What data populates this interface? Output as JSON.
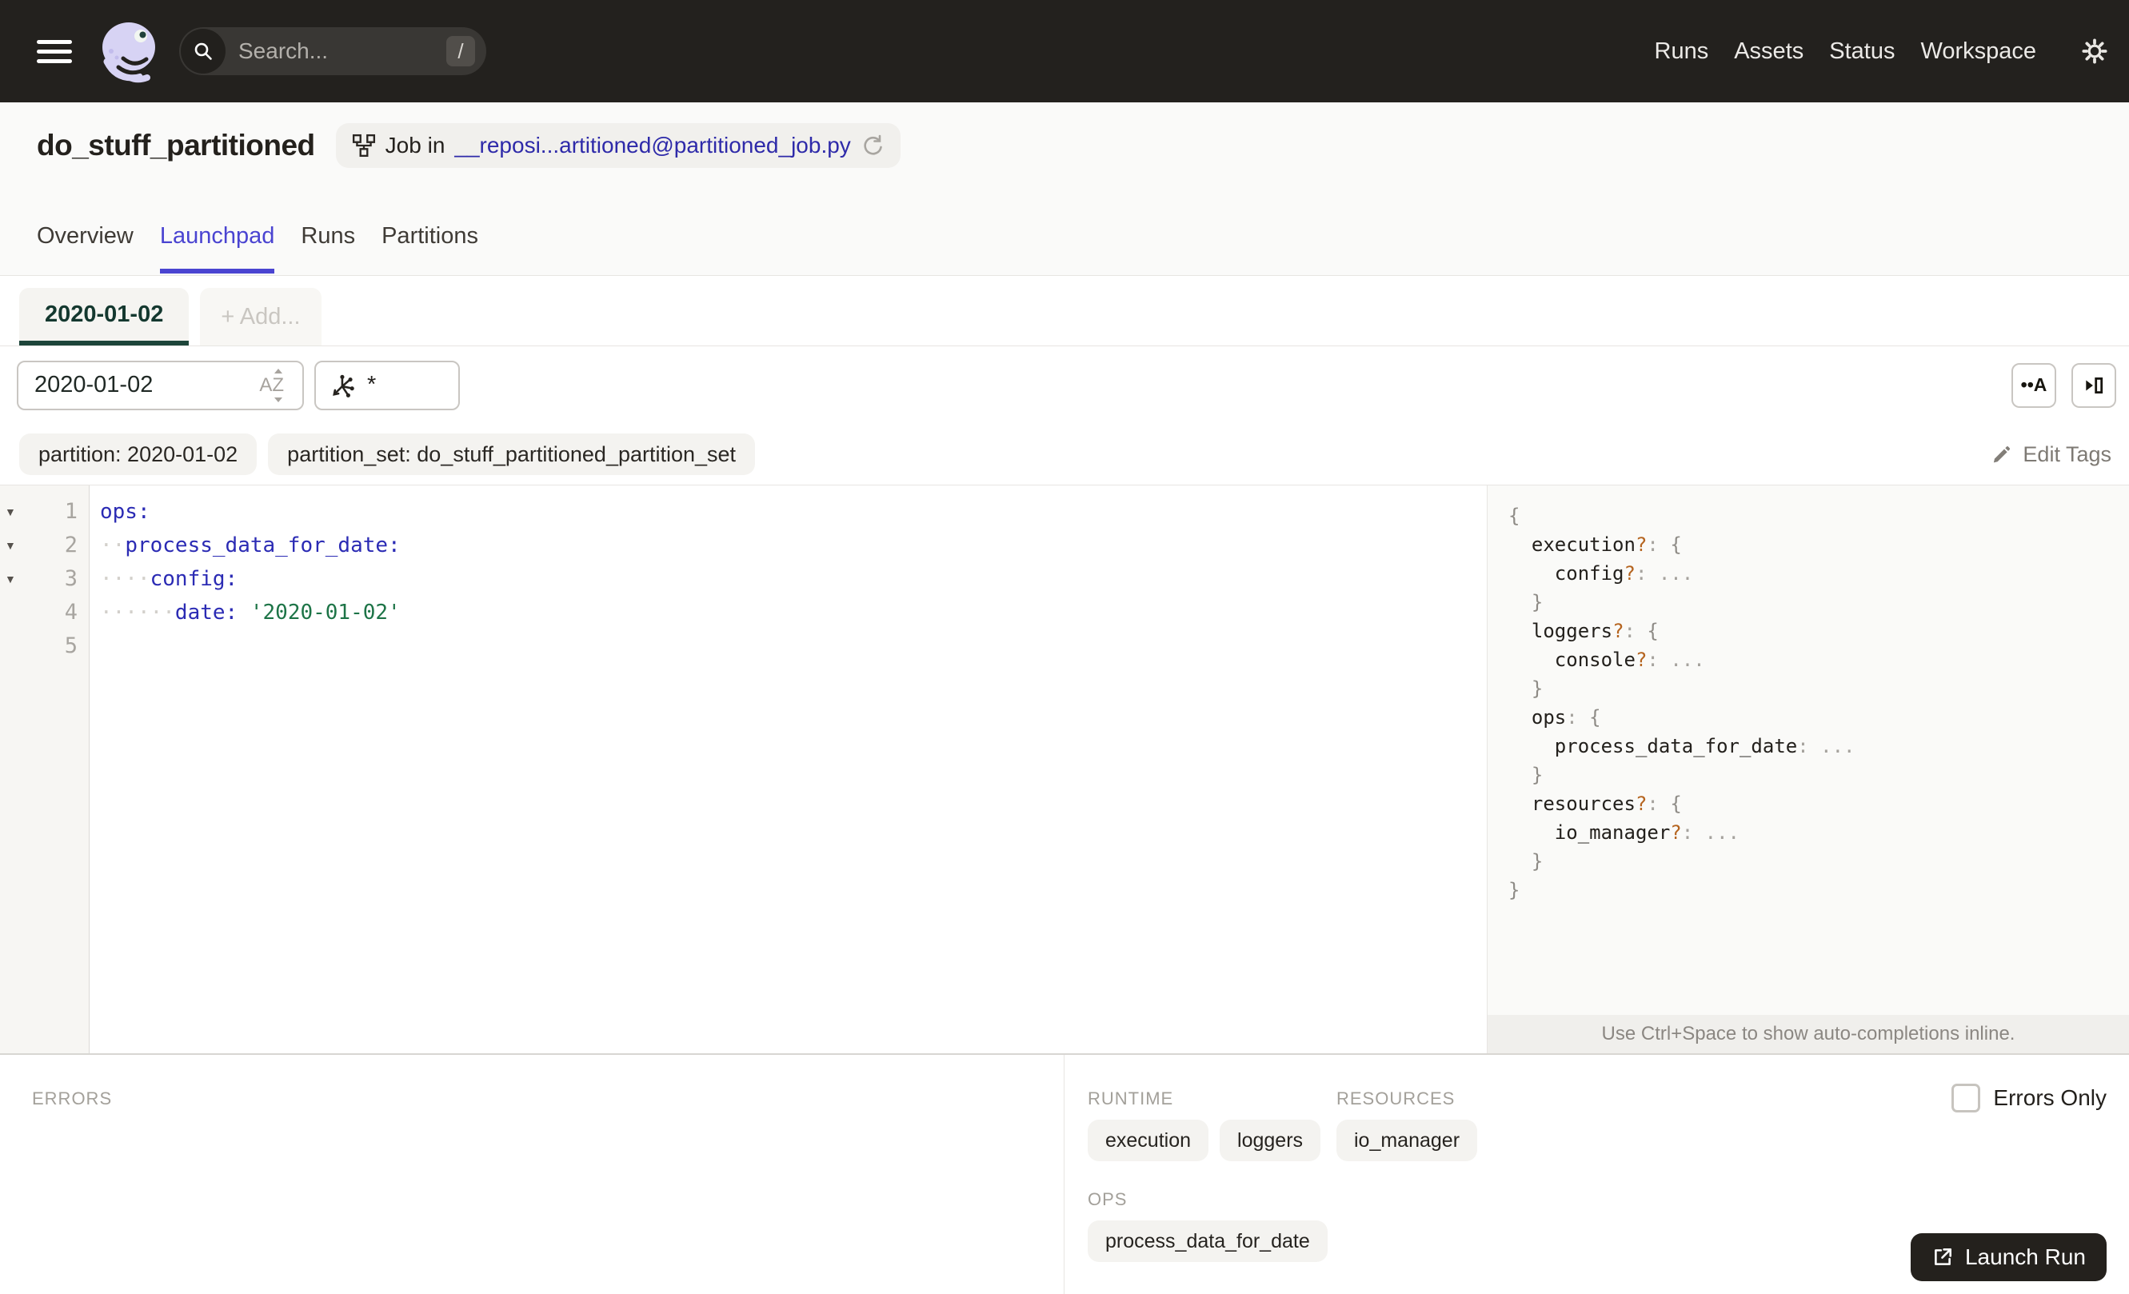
{
  "colors": {
    "accent": "#4a44d1",
    "link": "#2e2aa9",
    "green": "#1d453a",
    "green_text": "#14382f",
    "code_key": "#2b2bb4",
    "code_str": "#1d7447",
    "opt": "#b5641f",
    "dark": "#24211d"
  },
  "icons": {
    "fold": "▼",
    "whitespace_toggle": "••A",
    "sort_letters": "AZ"
  },
  "nav": {
    "search_placeholder": "Search...",
    "search_shortcut": "/",
    "links": [
      "Runs",
      "Assets",
      "Status",
      "Workspace"
    ]
  },
  "header": {
    "title": "do_stuff_partitioned",
    "badge_prefix": "Job in",
    "badge_link": "__reposi...artitioned@partitioned_job.py",
    "tabs": [
      {
        "label": "Overview",
        "active": false
      },
      {
        "label": "Launchpad",
        "active": true
      },
      {
        "label": "Runs",
        "active": false
      },
      {
        "label": "Partitions",
        "active": false
      }
    ]
  },
  "launchpad": {
    "config_tabs": [
      {
        "label": "2020-01-02",
        "type": "partition",
        "active": true
      },
      {
        "label": "+ Add...",
        "type": "add",
        "active": false
      }
    ],
    "partition_value": "2020-01-02",
    "op_selector_value": "*",
    "tags": [
      "partition: 2020-01-02",
      "partition_set: do_stuff_partitioned_partition_set"
    ],
    "edit_tags_label": "Edit Tags",
    "editor_lines": [
      {
        "num": 1,
        "fold": true,
        "tokens": [
          {
            "t": "key",
            "v": "ops:"
          }
        ]
      },
      {
        "num": 2,
        "fold": true,
        "tokens": [
          {
            "t": "ws",
            "v": "··"
          },
          {
            "t": "key",
            "v": "process_data_for_date:"
          }
        ]
      },
      {
        "num": 3,
        "fold": true,
        "tokens": [
          {
            "t": "ws",
            "v": "····"
          },
          {
            "t": "key",
            "v": "config:"
          }
        ]
      },
      {
        "num": 4,
        "fold": false,
        "tokens": [
          {
            "t": "ws",
            "v": "······"
          },
          {
            "t": "key",
            "v": "date:"
          },
          {
            "t": "plain",
            "v": " "
          },
          {
            "t": "str",
            "v": "'2020-01-02'"
          }
        ]
      },
      {
        "num": 5,
        "fold": false,
        "tokens": []
      }
    ],
    "schema_lines": [
      [
        {
          "t": "brace",
          "v": "{"
        }
      ],
      [
        {
          "t": "pun",
          "v": "  "
        },
        {
          "t": "key",
          "v": "execution"
        },
        {
          "t": "opt",
          "v": "?"
        },
        {
          "t": "pun",
          "v": ": "
        },
        {
          "t": "brace",
          "v": "{"
        }
      ],
      [
        {
          "t": "pun",
          "v": "    "
        },
        {
          "t": "key",
          "v": "config"
        },
        {
          "t": "opt",
          "v": "?"
        },
        {
          "t": "pun",
          "v": ": "
        },
        {
          "t": "dots",
          "v": "..."
        }
      ],
      [
        {
          "t": "pun",
          "v": "  "
        },
        {
          "t": "brace",
          "v": "}"
        }
      ],
      [
        {
          "t": "pun",
          "v": "  "
        },
        {
          "t": "key",
          "v": "loggers"
        },
        {
          "t": "opt",
          "v": "?"
        },
        {
          "t": "pun",
          "v": ": "
        },
        {
          "t": "brace",
          "v": "{"
        }
      ],
      [
        {
          "t": "pun",
          "v": "    "
        },
        {
          "t": "key",
          "v": "console"
        },
        {
          "t": "opt",
          "v": "?"
        },
        {
          "t": "pun",
          "v": ": "
        },
        {
          "t": "dots",
          "v": "..."
        }
      ],
      [
        {
          "t": "pun",
          "v": "  "
        },
        {
          "t": "brace",
          "v": "}"
        }
      ],
      [
        {
          "t": "pun",
          "v": "  "
        },
        {
          "t": "key",
          "v": "ops"
        },
        {
          "t": "pun",
          "v": ": "
        },
        {
          "t": "brace",
          "v": "{"
        }
      ],
      [
        {
          "t": "pun",
          "v": "    "
        },
        {
          "t": "key",
          "v": "process_data_for_date"
        },
        {
          "t": "pun",
          "v": ": "
        },
        {
          "t": "dots",
          "v": "..."
        }
      ],
      [
        {
          "t": "pun",
          "v": "  "
        },
        {
          "t": "brace",
          "v": "}"
        }
      ],
      [
        {
          "t": "pun",
          "v": "  "
        },
        {
          "t": "key",
          "v": "resources"
        },
        {
          "t": "opt",
          "v": "?"
        },
        {
          "t": "pun",
          "v": ": "
        },
        {
          "t": "brace",
          "v": "{"
        }
      ],
      [
        {
          "t": "pun",
          "v": "    "
        },
        {
          "t": "key",
          "v": "io_manager"
        },
        {
          "t": "opt",
          "v": "?"
        },
        {
          "t": "pun",
          "v": ": "
        },
        {
          "t": "dots",
          "v": "..."
        }
      ],
      [
        {
          "t": "pun",
          "v": "  "
        },
        {
          "t": "brace",
          "v": "}"
        }
      ],
      [
        {
          "t": "brace",
          "v": "}"
        }
      ]
    ],
    "hint": "Use Ctrl+Space to show auto-completions inline."
  },
  "bottom": {
    "errors_label": "ERRORS",
    "runtime_label": "RUNTIME",
    "resources_label": "RESOURCES",
    "ops_label": "OPS",
    "runtime_pills": [
      "execution",
      "loggers"
    ],
    "resources_pills": [
      "io_manager"
    ],
    "ops_pills": [
      "process_data_for_date"
    ],
    "errors_only_label": "Errors Only",
    "launch_label": "Launch Run"
  }
}
